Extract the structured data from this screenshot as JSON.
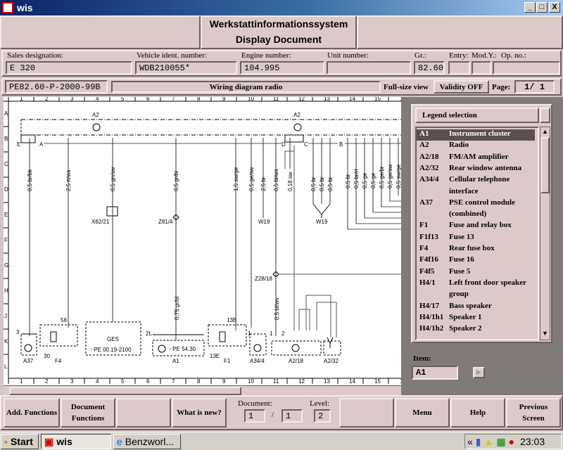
{
  "window": {
    "title": "wis",
    "minimize": "_",
    "maximize": "□",
    "close": "X"
  },
  "header": {
    "line1": "Werkstattinformationssystem",
    "line2": "Display Document"
  },
  "fields": [
    {
      "label": "Sales designation:",
      "value": "E 320"
    },
    {
      "label": "Vehicle ident. number:",
      "value": "WDB210055*"
    },
    {
      "label": "Engine number:",
      "value": "104.995"
    },
    {
      "label": "Unit number:",
      "value": ""
    },
    {
      "label": "Gr.:",
      "value": "82.60"
    },
    {
      "label": "Entry:",
      "value": ""
    },
    {
      "label": "Mod.Y.:",
      "value": ""
    },
    {
      "label": "Op. no.:",
      "value": ""
    }
  ],
  "document": {
    "code": "PE82.60-P-2000-99B",
    "title": "Wiring diagram radio",
    "full_size": "Full-size view",
    "validity": "Validity OFF",
    "page_label": "Page:",
    "page_value": "1/  1"
  },
  "diagram": {
    "columns": [
      "1",
      "2",
      "3",
      "4",
      "5",
      "6",
      "7",
      "8",
      "9",
      "10",
      "11",
      "12",
      "13",
      "14",
      "15",
      "16"
    ],
    "rows": [
      "A",
      "B",
      "C",
      "D",
      "E",
      "F",
      "G",
      "H",
      "J",
      "K",
      "L"
    ],
    "labels": {
      "a2_left": "A2",
      "a2_right": "A2",
      "conn_e": "E",
      "conn_a": "A",
      "conn_d": "D",
      "conn_c": "C",
      "conn_b": "B",
      "x62": "X62/21",
      "z81": "Z81/4",
      "w19a": "W19",
      "w19b": "W19",
      "z28": "Z28/18",
      "ges": "GES",
      "ges_ref": "☞PE 00.19-2100",
      "a1_ref": "☞PE 54.30",
      "a37": "A37",
      "f4": "F4",
      "a1": "A1",
      "f1": "F1",
      "a344": "A34/4",
      "a218": "A2/18",
      "a232": "A2/32",
      "f4_58": "58",
      "f4_30": "30",
      "f1_13b": "13B",
      "f1_13e": "13E",
      "pin3": "3",
      "pin2l": "2L",
      "pin1": "1",
      "pin1b": "1",
      "pin2": "2",
      "j_wire": "0,75 gr/bl",
      "j_wire2": "0,5 bl/ws"
    },
    "wires": [
      "0,5 br/bk",
      "2,5 rt/ws",
      "0,5 gn/sw",
      "0,5 gr/bl",
      "1,5 sw/ge",
      "0,5 ge/sw",
      "2,5 br",
      "0,5 bl/ws",
      "0,18 sw",
      "0,5 br",
      "0,5 br",
      "0,5 br",
      "0,5 br",
      "0,5 br/rt",
      "0,5 ge",
      "0,5 ge",
      "0,5 ge/br",
      "0,5 ge/sw",
      "0,5 sw/ge"
    ]
  },
  "legend": {
    "title": "Legend selection",
    "item_label": "Item:",
    "item_value": "A1",
    "items": [
      {
        "code": "A1",
        "name": "Instrument cluster",
        "selected": true
      },
      {
        "code": "A2",
        "name": "Radio"
      },
      {
        "code": "A2/18",
        "name": "FM/AM amplifier"
      },
      {
        "code": "A2/32",
        "name": "Rear window antenna"
      },
      {
        "code": "A34/4",
        "name": "Cellular telephone"
      },
      {
        "code": "",
        "name": "interface"
      },
      {
        "code": "A37",
        "name": "PSE control module"
      },
      {
        "code": "",
        "name": "(combined)"
      },
      {
        "code": "F1",
        "name": "Fuse and relay box"
      },
      {
        "code": "F1f13",
        "name": "Fuse 13"
      },
      {
        "code": "F4",
        "name": "Rear fuse box"
      },
      {
        "code": "F4f16",
        "name": "Fuse 16"
      },
      {
        "code": "F4f5",
        "name": "Fuse 5"
      },
      {
        "code": "H4/1",
        "name": "Left front door speaker"
      },
      {
        "code": "",
        "name": "group"
      },
      {
        "code": "H4/17",
        "name": "Bass speaker"
      },
      {
        "code": "H4/1h1",
        "name": "Speaker 1"
      },
      {
        "code": "H4/1h2",
        "name": "Speaker 2"
      }
    ]
  },
  "footer": {
    "add": "Add. Functions",
    "docfn": "Document Functions",
    "new": "What is new?",
    "doc_label": "Document:",
    "doc_value": "1",
    "doc_sep": "/",
    "doc_total": "1",
    "level_label": "Level:",
    "level_value": "2",
    "menu": "Menu",
    "help": "Help",
    "prev": "Previous Screen"
  },
  "taskbar": {
    "start": "Start",
    "task1": "wis",
    "task2": "Benzworl...",
    "chevron": "«",
    "clock": "23:03"
  }
}
